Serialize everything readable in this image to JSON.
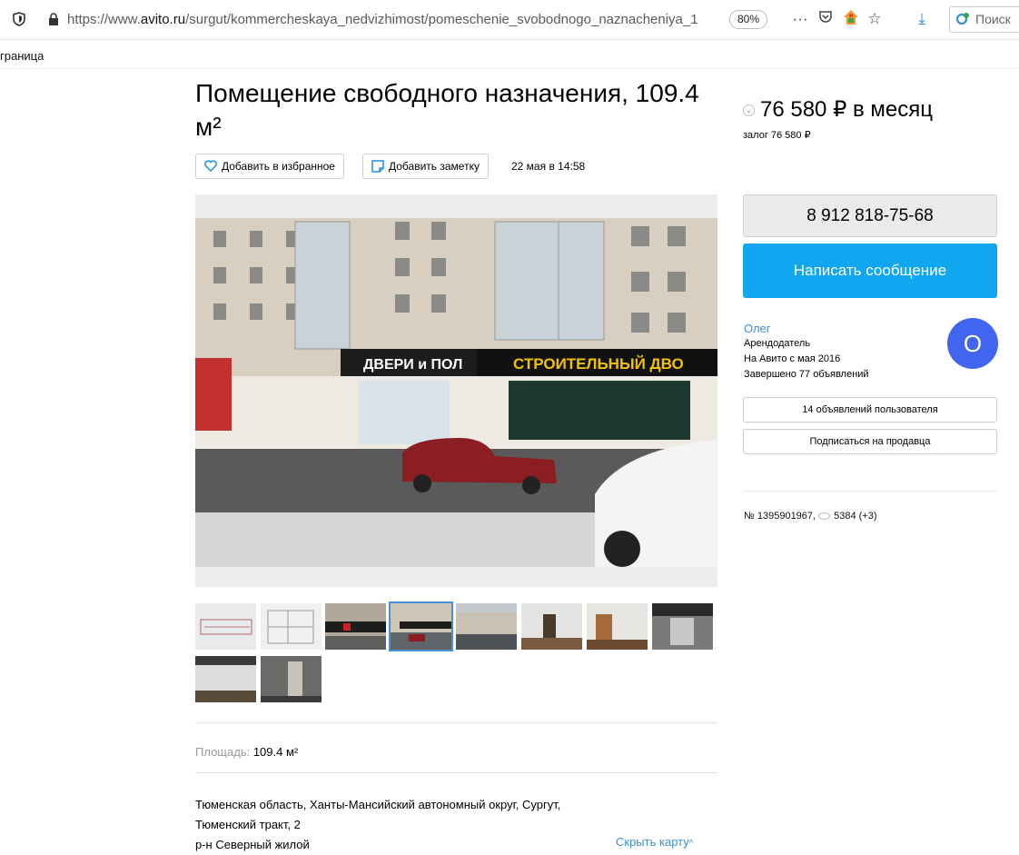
{
  "browser": {
    "url_prefix": "https://www.",
    "url_domain": "avito.ru",
    "url_path": "/surgut/kommercheskaya_nedvizhimost/pomeschenie_svobodnogo_naznacheniya_1",
    "zoom": "80%",
    "search_placeholder": "Поиск",
    "tab_fragment": "граница"
  },
  "listing": {
    "title": "Помещение свободного назначения, 109.4 м²",
    "favorite_label": "Добавить в избранное",
    "note_label": "Добавить заметку",
    "date": "22 мая в 14:58",
    "area_label": "Площадь:",
    "area_value": "109.4 м²",
    "address_line1": "Тюменская область, Ханты-Мансийский автономный округ, Сургут,",
    "address_line2": "Тюменский тракт, 2",
    "district": "р-н Северный жилой",
    "hide_map": "Скрыть карту",
    "photo_signs": {
      "sign_doors": "ДВЕРИ и ПОЛ",
      "sign_store": "СТРОИТЕЛЬНЫЙ ДВО"
    }
  },
  "sidebar": {
    "price": "76 580 ₽ в месяц",
    "deposit": "залог 76 580 ₽",
    "phone": "8 912 818-75-68",
    "message_button": "Написать сообщение",
    "seller_name": "Олег",
    "seller_role": "Арендодатель",
    "seller_since": "На Авито с мая 2016",
    "seller_completed": "Завершено 77 объявлений",
    "avatar_letter": "О",
    "user_listings_button": "14 объявлений пользователя",
    "subscribe_button": "Подписаться на продавца",
    "listing_number": "№ 1395901967,",
    "views": "5384 (+3)"
  },
  "colors": {
    "accent_blue": "#11a7f0",
    "avatar_blue": "#4265f0",
    "link_blue": "#3a8fd9"
  }
}
